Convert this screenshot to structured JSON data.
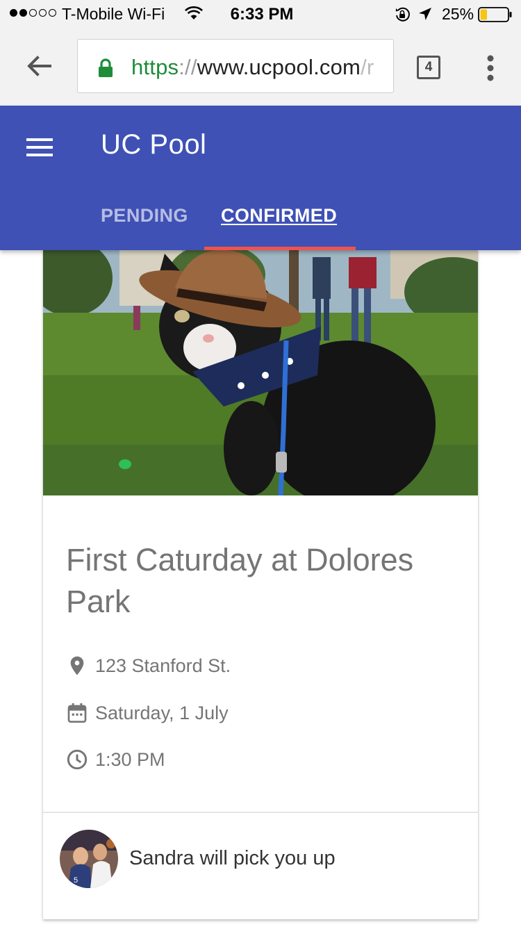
{
  "status_bar": {
    "carrier": "T-Mobile Wi-Fi",
    "time": "6:33 PM",
    "battery_percent": "25%",
    "battery_level": 0.25,
    "signal_bars_filled": 2,
    "signal_bars_total": 5
  },
  "browser": {
    "url_scheme": "https",
    "url_separator": "://",
    "url_host": "www.ucpool.com",
    "url_tail": "/r",
    "tab_count": "4"
  },
  "app": {
    "title": "UC Pool",
    "tabs": [
      {
        "label": "PENDING",
        "selected": false
      },
      {
        "label": "CONFIRMED",
        "selected": true
      }
    ],
    "primary_color": "#3f51b5",
    "tab_indicator_color": "#ef5350"
  },
  "event": {
    "title": "First Caturday at Dolores Park",
    "address": "123 Stanford St.",
    "date": "Saturday, 1 July",
    "time": "1:30 PM",
    "driver_message": "Sandra will pick you up"
  },
  "icons": {
    "wifi": "wifi-icon",
    "lock_rotation": "orientation-lock-icon",
    "location": "location-arrow-icon",
    "battery": "battery-icon",
    "back": "back-arrow-icon",
    "secure": "padlock-icon",
    "tabs": "tabs-count-icon",
    "overflow": "more-vert-icon",
    "menu": "hamburger-menu-icon",
    "place": "place-pin-icon",
    "calendar": "calendar-icon",
    "clock": "clock-icon"
  }
}
